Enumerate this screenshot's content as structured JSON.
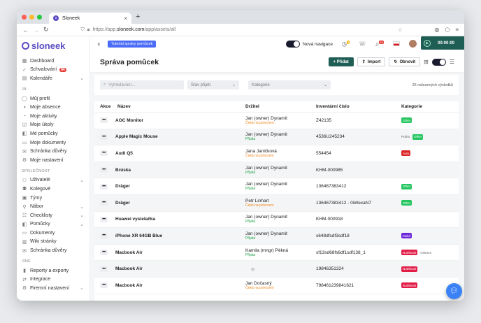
{
  "browser": {
    "tab_title": "Sloneek",
    "url_prefix": "https://app.",
    "url_domain": "sloneek.com",
    "url_path": "/app/assets/all"
  },
  "sidebar": {
    "logo": "sloneek",
    "items_top": [
      {
        "label": "Dashboard",
        "icon": "grid-icon"
      },
      {
        "label": "Schvalování",
        "icon": "check-icon",
        "badge": "84"
      },
      {
        "label": "Kalendáře",
        "icon": "calendar-icon",
        "chevron": true
      }
    ],
    "section_ja": "JÁ",
    "items_ja": [
      {
        "label": "Můj profil",
        "icon": "user-icon"
      },
      {
        "label": "Moje absence",
        "icon": "absence-icon"
      },
      {
        "label": "Moje aktivity",
        "icon": "activity-icon"
      },
      {
        "label": "Moje úkoly",
        "icon": "task-icon"
      },
      {
        "label": "Mé pomůcky",
        "icon": "asset-icon"
      },
      {
        "label": "Moje dokumenty",
        "icon": "folder-icon"
      },
      {
        "label": "Schránka důvěry",
        "icon": "inbox-icon"
      },
      {
        "label": "Moje nastavení",
        "icon": "settings-icon"
      }
    ],
    "section_spolecnost": "SPOLEČNOST",
    "items_spolecnost": [
      {
        "label": "Uživatelé",
        "icon": "users-icon",
        "chevron": true
      },
      {
        "label": "Kolegové",
        "icon": "colleagues-icon"
      },
      {
        "label": "Týmy",
        "icon": "teams-icon"
      },
      {
        "label": "Nábor",
        "icon": "recruit-icon",
        "chevron": true
      },
      {
        "label": "Checklisty",
        "icon": "checklist-icon",
        "chevron": true
      },
      {
        "label": "Pomůcky",
        "icon": "asset-icon",
        "chevron": true
      },
      {
        "label": "Dokumenty",
        "icon": "folder-icon"
      },
      {
        "label": "Wiki stránky",
        "icon": "wiki-icon"
      },
      {
        "label": "Schránka důvěry",
        "icon": "inbox-icon"
      }
    ],
    "section_jine": "JINÉ",
    "items_jine": [
      {
        "label": "Reporty a exporty",
        "icon": "report-icon"
      },
      {
        "label": "Integrace",
        "icon": "integration-icon"
      },
      {
        "label": "Firemní nastavení",
        "icon": "settings-icon",
        "chevron": true
      }
    ]
  },
  "topbar": {
    "tutorial": "Tutoriál správy pomůcek",
    "new_nav": "Nová navigace",
    "timer": "00:00:00",
    "notif_count": "3",
    "bell_count": "18"
  },
  "page": {
    "title": "Správa pomůcek",
    "add_label": "+ Přidat",
    "import_label": "Import",
    "refresh_label": "Obnovit"
  },
  "filters": {
    "search_placeholder": "Vyhledávání...",
    "status": "Stav přijetí",
    "category": "Kategorie",
    "count": "25 nalezených výsledků"
  },
  "table": {
    "headers": [
      "Akce",
      "Název",
      "Držitel",
      "Inventární číslo",
      "Kategorie"
    ],
    "rows": [
      {
        "name": "AOC Monitor",
        "holder": "Jan (owner) Dynamit",
        "status": "Čeká na potvrzení",
        "status_color": "#f08a24",
        "inv": "Z42135",
        "cats": [
          {
            "t": "Other",
            "c": "#22c55e"
          }
        ]
      },
      {
        "name": "Apple Magic Mouse",
        "holder": "Jan (owner) Dynamit",
        "status": "Přijata",
        "status_color": "#22a34a",
        "inv": "4536U245234",
        "cats": [
          {
            "t": "Praha",
            "c": ""
          },
          {
            "t": "Other",
            "c": "#22c55e"
          }
        ]
      },
      {
        "name": "Audi Q5",
        "holder": "Jana Janičková",
        "status": "Čeká na potvrzení",
        "status_color": "#f08a24",
        "inv": "554454",
        "cats": [
          {
            "t": "Auto",
            "c": "#dc2626"
          }
        ]
      },
      {
        "name": "Brúska",
        "holder": "Jan (owner) Dynamit",
        "status": "Přijata",
        "status_color": "#22a34a",
        "inv": "KHM-000985",
        "cats": []
      },
      {
        "name": "Dräger",
        "holder": "Jan (owner) Dynamit",
        "status": "Přijata",
        "status_color": "#22a34a",
        "inv": "136467383412",
        "cats": [
          {
            "t": "Other",
            "c": "#22c55e"
          }
        ]
      },
      {
        "name": "Dräger",
        "holder": "Petr Linhart",
        "status": "Čeká na potvrzení",
        "status_color": "#f08a24",
        "inv": "136467383412 - 0iWexaN7",
        "cats": [
          {
            "t": "Other",
            "c": "#22c55e"
          }
        ]
      },
      {
        "name": "Huawei vysielačka",
        "holder": "Jan (owner) Dynamit",
        "status": "Přijata",
        "status_color": "#22a34a",
        "inv": "KHM-000918",
        "cats": []
      },
      {
        "name": "iPhone XR 64GB Blue",
        "holder": "Jan (owner) Dynamit",
        "status": "Přijata",
        "status_color": "#22a34a",
        "inv": "s648dfsdf3sdf18",
        "cats": [
          {
            "t": "Mobil",
            "c": "#6d28d9"
          }
        ]
      },
      {
        "name": "Macbook Air",
        "holder": "Kamila (mngr) Pěkná",
        "status": "Přijata",
        "status_color": "#22a34a",
        "inv": "sf13sd68fs6df1sdf138_1",
        "cats": [
          {
            "t": "Notebook",
            "c": "#e11d48"
          },
          {
            "t": "Ostrava",
            "c": ""
          }
        ]
      },
      {
        "name": "Macbook Air",
        "holder": "",
        "status": "",
        "status_color": "",
        "inv": "19846351324",
        "cats": [
          {
            "t": "Notebook",
            "c": "#e11d48"
          }
        ]
      },
      {
        "name": "Macbook Air",
        "holder": "Jan Dočasný",
        "status": "Čeká na potvrzení",
        "status_color": "#f08a24",
        "inv": "798461239841621",
        "cats": [
          {
            "t": "Notebook",
            "c": "#e11d48"
          }
        ]
      }
    ]
  }
}
